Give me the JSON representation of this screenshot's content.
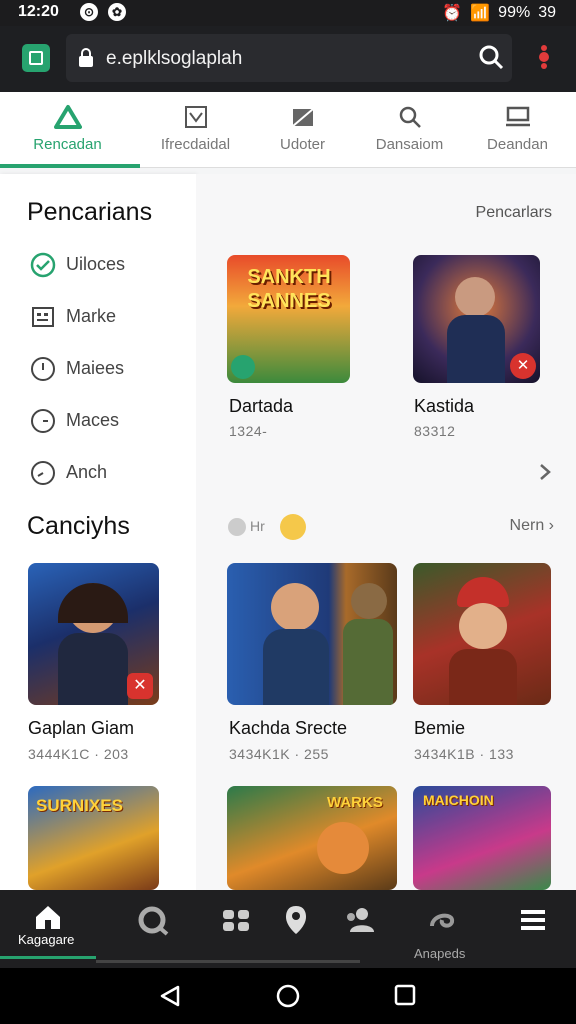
{
  "status_bar": {
    "time": "12:20",
    "battery": "99%",
    "extra": "39"
  },
  "browser": {
    "url": "e.eplklsoglaplah",
    "icons": [
      "app-logo-icon",
      "lock-icon",
      "search-icon",
      "more-menu-icon"
    ]
  },
  "tabs": [
    {
      "label": "Rencadan",
      "icon": "triangle-icon"
    },
    {
      "label": "Ifrecdaidal",
      "icon": "checkbox-icon"
    },
    {
      "label": "Udoter",
      "icon": "folder-icon"
    },
    {
      "label": "Dansaiom",
      "icon": "search-icon"
    },
    {
      "label": "Deandan",
      "icon": "laptop-icon"
    }
  ],
  "sidebar": {
    "title1": "Pencarians",
    "items": [
      {
        "label": "Uiloces",
        "icon": "check-circle-icon"
      },
      {
        "label": "Marke",
        "icon": "grid-box-icon"
      },
      {
        "label": "Maiees",
        "icon": "clock-icon"
      },
      {
        "label": "Maces",
        "icon": "clock-icon"
      },
      {
        "label": "Anch",
        "icon": "clock-icon"
      }
    ],
    "title2": "Canciyhs",
    "card": {
      "name": "Gaplan Giam",
      "meta": "3444K1C · 203"
    }
  },
  "main": {
    "section1_link": "Pencarlars",
    "cards_row1": [
      {
        "name": "Dartada",
        "meta": "1324-",
        "thumb_text": "SANKTH SANNES"
      },
      {
        "name": "Kastida",
        "meta": "83312"
      }
    ],
    "section2_label": "Hr",
    "section2_link": "Nern",
    "cards_row2": [
      {
        "name": "Kachda Srecte",
        "meta": "3434K1K · 255"
      },
      {
        "name": "Bemie",
        "meta": "3434K1B · 133"
      }
    ],
    "row3_texts": [
      "SURNIXES",
      "WARKS",
      "MAICHOIN"
    ]
  },
  "bottom_nav": [
    {
      "label": "Kagagare",
      "icon": "home-icon"
    },
    {
      "label": "",
      "icon": "search-icon"
    },
    {
      "label": "",
      "icon": "gamepad-icon"
    },
    {
      "label": "",
      "icon": "shield-icon"
    },
    {
      "label": "",
      "icon": "people-icon"
    },
    {
      "label": "Anapeds",
      "icon": "spiral-icon"
    },
    {
      "label": "",
      "icon": "menu-icon"
    }
  ],
  "colors": {
    "accent": "#27a36f",
    "dark": "#1e1f22"
  }
}
